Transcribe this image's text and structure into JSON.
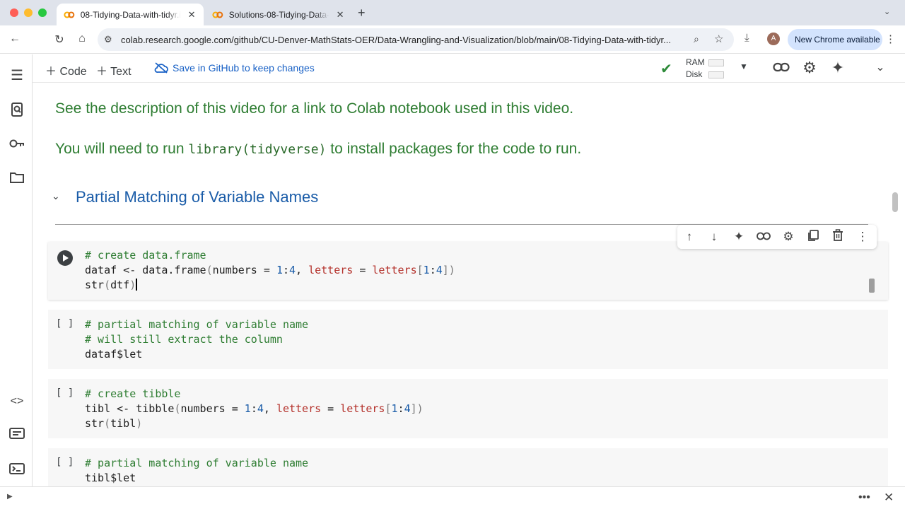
{
  "browser": {
    "tabs": [
      {
        "title": "08-Tidying-Data-with-tidyr.ipynb",
        "active": true
      },
      {
        "title": "Solutions-08-Tidying-Data-with-tidyr.ipynb",
        "active": false
      }
    ],
    "new_tab": "+",
    "url": "colab.research.google.com/github/CU-Denver-MathStats-OER/Data-Wrangling-and-Visualization/blob/main/08-Tidying-Data-with-tidyr...",
    "profile_initial": "A",
    "update_label": "New Chrome available",
    "traffic_colors": [
      "#fe5f57",
      "#febc2e",
      "#28c840"
    ]
  },
  "colab_toolbar": {
    "code_label": "Code",
    "text_label": "Text",
    "save_label": "Save in GitHub to keep changes",
    "ram_label": "RAM",
    "disk_label": "Disk"
  },
  "notebook": {
    "md_line1": "See the description of this video for a link to Colab notebook used in this video.",
    "md_line2_prefix": "You will need to run ",
    "md_line2_code": "library(tidyverse)",
    "md_line2_suffix": " to install packages for the code to run.",
    "section_heading": "Partial Matching of Variable Names",
    "cell_bracket": "[ ]",
    "cells": [
      {
        "lines": [
          "# create data.frame",
          "dataf <- data.frame(numbers = 1:4, letters = letters[1:4])",
          "str(dtf)"
        ]
      },
      {
        "lines": [
          "# partial matching of variable name",
          "# will still extract the column",
          "dataf$let"
        ]
      },
      {
        "lines": [
          "# create tibble",
          "tibl <- tibble(numbers = 1:4, letters = letters[1:4])",
          "str(tibl)"
        ]
      },
      {
        "lines": [
          "# partial matching of variable name",
          "tibl$let"
        ]
      }
    ]
  },
  "colors": {
    "markdown_green": "#2e7d32",
    "heading_blue": "#1a5ca8",
    "string_red": "#b4312b",
    "link_blue": "#1a62c6"
  }
}
